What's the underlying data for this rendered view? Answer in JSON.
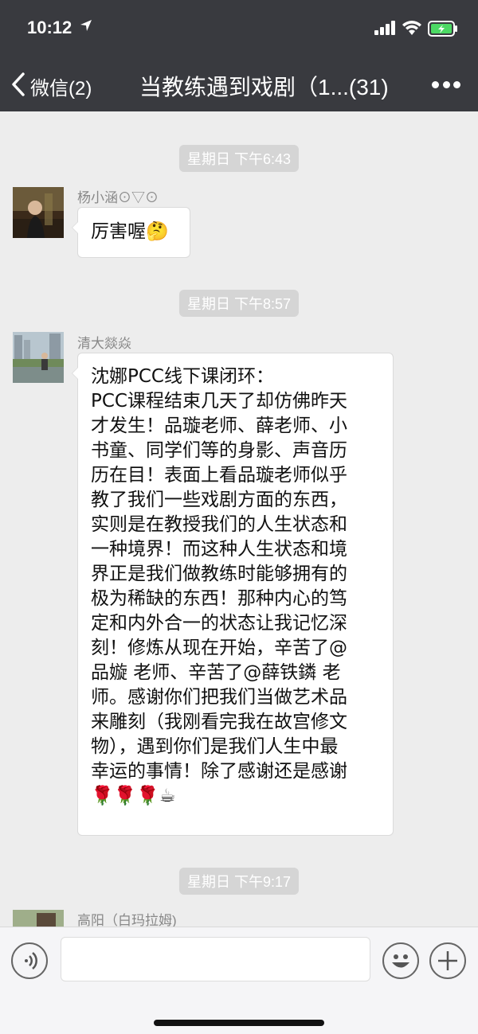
{
  "status_bar": {
    "time": "10:12"
  },
  "nav": {
    "back_label": "微信(2)",
    "title": "当教练遇到戏剧（1...(31)"
  },
  "messages": [
    {
      "timestamp": "星期日 下午6:43",
      "sender": "杨小涵⊙▽⊙",
      "text": "厉害喔🤔"
    },
    {
      "timestamp": "星期日 下午8:57",
      "sender": "清大燚焱",
      "lines": [
        "沈娜PCC线下课闭环：",
        "PCC课程结束几天了却仿佛昨天",
        "才发生！品璇老师、薛老师、小",
        "书童、同学们等的身影、声音历",
        "历在目！表面上看品璇老师似乎",
        "教了我们一些戏剧方面的东西，",
        "实则是在教授我们的人生状态和",
        "一种境界！而这种人生状态和境",
        "界正是我们做教练时能够拥有的",
        "极为稀缺的东西！那种内心的笃",
        "定和内外合一的状态让我记忆深",
        "刻！修炼从现在开始，辛苦了@",
        "品嫙 老师、辛苦了@薛铁鏻 老",
        "师。感谢你们把我们当做艺术品",
        "来雕刻（我刚看完我在故宫修文",
        "物），遇到你们是我们人生中最",
        "幸运的事情！除了感谢还是感谢",
        "🌹🌹🌹☕"
      ]
    },
    {
      "timestamp": "星期日 下午9:17",
      "sender": "高阳（白玛拉姆)"
    }
  ],
  "icons": {
    "location": "location-arrow-icon",
    "signal": "signal-icon",
    "wifi": "wifi-icon",
    "battery": "battery-charging-icon",
    "back": "chevron-left-icon",
    "more": "more-dots-icon",
    "voice": "voice-icon",
    "emoji": "emoji-icon",
    "plus": "plus-icon"
  },
  "colors": {
    "nav_bg": "#393a3f",
    "chat_bg": "#ededed",
    "bubble_bg": "#ffffff",
    "battery_green": "#4cd964"
  }
}
